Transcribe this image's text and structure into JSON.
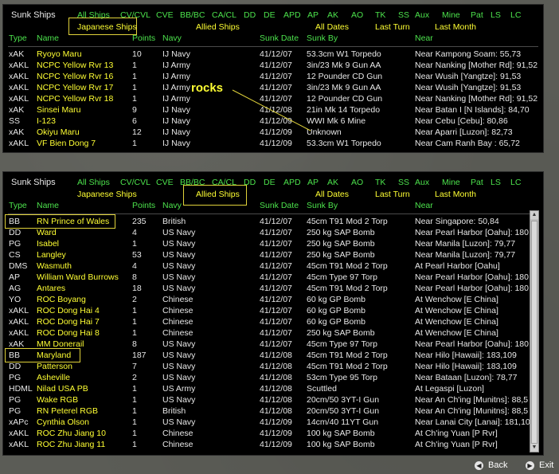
{
  "filters": [
    "All Ships",
    "CV/CVL",
    "CVE",
    "BB/BC",
    "CA/CL",
    "DD",
    "DE",
    "APD",
    "AP",
    "AK",
    "AO",
    "TK",
    "SS",
    "Aux",
    "Mine",
    "Pat",
    "LS",
    "LC"
  ],
  "subtabs": [
    "Japanese Ships",
    "Allied Ships",
    "All Dates",
    "Last Turn",
    "Last Month"
  ],
  "columns": [
    "Type",
    "Name",
    "Points",
    "Navy",
    "Sunk Date",
    "Sunk By",
    "Near"
  ],
  "top": {
    "title": "Sunk Ships",
    "rows": [
      [
        "xAK",
        "Ryoyo Maru",
        "10",
        "IJ Navy",
        "41/12/07",
        "53.3cm W1 Torpedo",
        "Near Kampong Soam: 55,73"
      ],
      [
        "xAKL",
        "NCPC Yellow Rvr 13",
        "1",
        "IJ Army",
        "41/12/07",
        "3in/23 Mk 9 Gun AA",
        "Near Nanking [Mother Rd]: 91,52"
      ],
      [
        "xAKL",
        "NCPC Yellow Rvr 16",
        "1",
        "IJ Army",
        "41/12/07",
        "12 Pounder CD Gun",
        "Near Wusih [Yangtze]: 91,53"
      ],
      [
        "xAKL",
        "NCPC Yellow Rvr 17",
        "1",
        "IJ Army",
        "41/12/07",
        "3in/23 Mk 9 Gun AA",
        "Near Wusih [Yangtze]: 91,53"
      ],
      [
        "xAKL",
        "NCPC Yellow Rvr 18",
        "1",
        "IJ Army",
        "41/12/07",
        "12 Pounder CD Gun",
        "Near Nanking [Mother Rd]: 91,52"
      ],
      [
        "xAK",
        "Sinsei Maru",
        "9",
        "IJ Navy",
        "41/12/08",
        "21in Mk 14 Torpedo",
        "Near Batan I [N Islands]: 84,70"
      ],
      [
        "SS",
        "I-123",
        "6",
        "IJ Navy",
        "41/12/09",
        "WWI Mk 6 Mine",
        "Near Cebu [Cebu]: 80,86"
      ],
      [
        "xAK",
        "Okiyu Maru",
        "12",
        "IJ Navy",
        "41/12/09",
        "Unknown",
        "Near Aparri [Luzon]: 82,73"
      ],
      [
        "xAKL",
        "VF Bien Dong 7",
        "1",
        "IJ Navy",
        "41/12/09",
        "53.3cm W1 Torpedo",
        "Near Cam Ranh Bay : 65,72"
      ]
    ]
  },
  "bottom": {
    "title": "Sunk Ships",
    "rows": [
      [
        "BB",
        "RN Prince of Wales",
        "235",
        "British",
        "41/12/07",
        "45cm T91 Mod 2 Torp",
        "Near Singapore: 50,84"
      ],
      [
        "DD",
        "Ward",
        "4",
        "US Navy",
        "41/12/07",
        "250 kg SAP Bomb",
        "Near Pearl Harbor [Oahu]: 180,"
      ],
      [
        "PG",
        "Isabel",
        "1",
        "US Navy",
        "41/12/07",
        "250 kg SAP Bomb",
        "Near Manila [Luzon]: 79,77"
      ],
      [
        "CS",
        "Langley",
        "53",
        "US Navy",
        "41/12/07",
        "250 kg SAP Bomb",
        "Near Manila [Luzon]: 79,77"
      ],
      [
        "DMS",
        "Wasmuth",
        "4",
        "US Navy",
        "41/12/07",
        "45cm T91 Mod 2 Torp",
        "At Pearl Harbor [Oahu]"
      ],
      [
        "AP",
        "William Ward Burrows",
        "8",
        "US Navy",
        "41/12/07",
        "45cm Type 97 Torp",
        "Near Pearl Harbor [Oahu]: 180,"
      ],
      [
        "AG",
        "Antares",
        "18",
        "US Navy",
        "41/12/07",
        "45cm T91 Mod 2 Torp",
        "Near Pearl Harbor [Oahu]: 180,"
      ],
      [
        "YO",
        "ROC Boyang",
        "2",
        "Chinese",
        "41/12/07",
        "60 kg GP Bomb",
        "At Wenchow [E China]"
      ],
      [
        "xAKL",
        "ROC Dong Hai 4",
        "1",
        "Chinese",
        "41/12/07",
        "60 kg GP Bomb",
        "At Wenchow [E China]"
      ],
      [
        "xAKL",
        "ROC Dong Hai 7",
        "1",
        "Chinese",
        "41/12/07",
        "60 kg GP Bomb",
        "At Wenchow [E China]"
      ],
      [
        "xAKL",
        "ROC Dong Hai 8",
        "1",
        "Chinese",
        "41/12/07",
        "250 kg SAP Bomb",
        "At Wenchow [E China]"
      ],
      [
        "xAK",
        "MM Donerail",
        "8",
        "US Navy",
        "41/12/07",
        "45cm Type 97 Torp",
        "Near Pearl Harbor [Oahu]: 180,"
      ],
      [
        "BB",
        "Maryland",
        "187",
        "US Navy",
        "41/12/08",
        "45cm T91 Mod 2 Torp",
        "Near Hilo [Hawaii]: 183,109"
      ],
      [
        "DD",
        "Patterson",
        "7",
        "US Navy",
        "41/12/08",
        "45cm T91 Mod 2 Torp",
        "Near Hilo [Hawaii]: 183,109"
      ],
      [
        "PG",
        "Asheville",
        "2",
        "US Navy",
        "41/12/08",
        "53cm Type 95 Torp",
        "Near Bataan [Luzon]: 78,77"
      ],
      [
        "HDML",
        "Nilad USA PB",
        "1",
        "US Army",
        "41/12/08",
        "Scuttled",
        "At Legaspi [Luzon]"
      ],
      [
        "PG",
        "Wake RGB",
        "1",
        "US Navy",
        "41/12/08",
        "20cm/50 3YT-I Gun",
        "Near An Ch'ing [Munitns]: 88,5"
      ],
      [
        "PG",
        "RN Peterel RGB",
        "1",
        "British",
        "41/12/08",
        "20cm/50 3YT-I Gun",
        "Near An Ch'ing [Munitns]: 88,5"
      ],
      [
        "xAPc",
        "Cynthia Olson",
        "1",
        "US Navy",
        "41/12/09",
        "14cm/40 11YT Gun",
        "Near Lanai City [Lanai]: 181,10"
      ],
      [
        "xAKL",
        "ROC Zhu Jiang 10",
        "1",
        "Chinese",
        "41/12/09",
        "100 kg SAP Bomb",
        "At Ch'ing Yuan [P Rvr]"
      ],
      [
        "xAKL",
        "ROC Zhu Jiang 11",
        "1",
        "Chinese",
        "41/12/09",
        "100 kg SAP Bomb",
        "At Ch'ing Yuan [P Rvr]"
      ]
    ]
  },
  "annotation": "rocks",
  "nav": {
    "back": "Back",
    "exit": "Exit"
  },
  "icons": {
    "back": "arrow-left-icon",
    "exit": "arrow-right-icon"
  },
  "colors": {
    "accent_green": "#4ce24c",
    "accent_yellow": "#ffff33",
    "highlight_box": "#e0d23a"
  }
}
